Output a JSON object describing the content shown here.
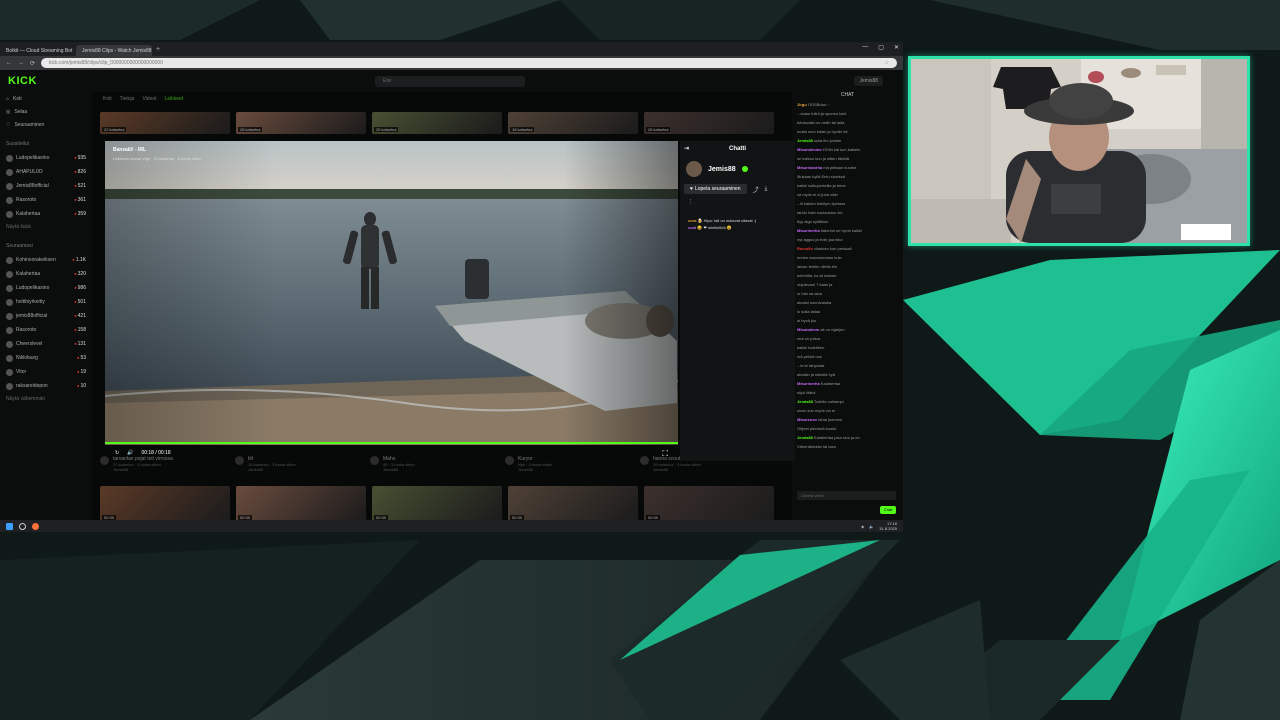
{
  "browser": {
    "tabs": [
      {
        "label": "Botkit — Cloud Streaming Bot",
        "color": "#e74c3c"
      },
      {
        "label": "Jemis88 Clips - Watch Jemis88",
        "color": "#53fc18"
      }
    ],
    "url": "kick.com/jemis88/clips/clip_0000000000000000000",
    "window_controls": [
      "—",
      "▢",
      "✕"
    ]
  },
  "kick": {
    "logo": "KICK",
    "search_placeholder": "Etsi",
    "user_button": "Jemis88",
    "nav": [
      {
        "label": "Koti",
        "icon": "home-icon"
      },
      {
        "label": "Selaa",
        "icon": "browse-icon"
      },
      {
        "label": "Seuraaminen",
        "icon": "heart-icon"
      }
    ],
    "recommended_label": "Suositellut",
    "recommended": [
      {
        "name": "Ludopelikasino",
        "count": "935"
      },
      {
        "name": "AHAPUL0O",
        "count": "826"
      },
      {
        "name": "Jemis88official",
        "count": "521"
      },
      {
        "name": "Rasoroto",
        "count": "361"
      },
      {
        "name": "Kalahertaa",
        "count": "359"
      }
    ],
    "show_more": "Näytä lisää",
    "following_label": "Seuraamasi",
    "following": [
      {
        "name": "Kohinoorakeiksen",
        "count": "1.1K"
      },
      {
        "name": "Kalahertaa",
        "count": "320"
      },
      {
        "name": "Ludopelikasino",
        "count": "986"
      },
      {
        "name": "hoitibiyrkeitty",
        "count": "501"
      },
      {
        "name": "jemis88official",
        "count": "421"
      },
      {
        "name": "Rasoroto",
        "count": "158"
      },
      {
        "name": "Cheerslevel",
        "count": "131"
      },
      {
        "name": "Nikkilaurg",
        "count": "53"
      },
      {
        "name": "Vitor",
        "count": "19"
      },
      {
        "name": "raksareidepon",
        "count": "10"
      }
    ],
    "show_less": "Näytä vähemmän",
    "content_tabs": [
      "Koti",
      "Tietoja",
      "Videot",
      "Leikkeet"
    ],
    "top_thumbs": [
      "22 katselua",
      "28 katselua",
      "25 katselua",
      "18 katselua",
      "28 katselua"
    ],
    "bottom_thumbs": [
      "00:30",
      "00:30",
      "00:30",
      "00:30",
      "00:30"
    ],
    "clip_cards": [
      {
        "title": "tarvanlan pojat teit virrossa",
        "sub": "27 katselua · 3 tuntia sitten",
        "author": "Jemis88"
      },
      {
        "title": "tiit",
        "sub": "15 katselua · 3 tuntia sitten",
        "author": "Jemis88"
      },
      {
        "title": "Maho",
        "sub": "45 · 3 tuntia sitten",
        "author": "Jemis88"
      },
      {
        "title": "Kuryor",
        "sub": "Nyk · 3 tuntia sitten",
        "author": "Jemis88"
      },
      {
        "title": "hanna scoutsia",
        "sub": "39 katselua · 3 tuntia sitten",
        "author": "Jemis88"
      }
    ],
    "page_chat": {
      "title": "CHAT",
      "lines": [
        {
          "user": "Jirgu",
          "text": "OOSBdoo ::",
          "color": "#e8a23a"
        },
        {
          "user": "",
          "text": "...ctaan tullut ja sponsu kuld",
          "color": ""
        },
        {
          "user": "",
          "text": "tuloisvalla on neliin tai laita",
          "color": ""
        },
        {
          "user": "",
          "text": "muita mun kalan ja hyvän ite",
          "color": ""
        },
        {
          "user": "Jemis88",
          "text": "sulla ibo joinlee",
          "color": "#53fc18"
        },
        {
          "user": "Misundenmo",
          "text": "HOlin kai kun katseis",
          "color": "#c86cfc"
        },
        {
          "user": "",
          "text": "se katsuo kun ja sitten ittekilä",
          "color": ""
        },
        {
          "user": "Misurinaorha",
          "text": "mä peltaan nuutse",
          "color": "#c86cfc"
        },
        {
          "user": "",
          "text": "Mukaan kyllä Entu siveissä",
          "color": ""
        },
        {
          "user": "",
          "text": "kaikki sulkuperteilla ja teme",
          "color": ""
        },
        {
          "user": "",
          "text": "sa myös ei ol juna näin",
          "color": ""
        },
        {
          "user": "",
          "text": "...ill kaiken birkitym lipelaus",
          "color": ""
        },
        {
          "user": "",
          "text": "tahdo hain suutaustuu kin",
          "color": ""
        },
        {
          "user": "",
          "text": "ttyy aigo kylläikun",
          "color": ""
        },
        {
          "user": "Misurinerha",
          "text": "tiatorimi on hyvin kaikki",
          "color": "#c86cfc"
        },
        {
          "user": "",
          "text": "nyt aggus ja bvbr jaa toko",
          "color": ""
        },
        {
          "user": "Rmcollo",
          "text": "vihainen kun pentaali",
          "color": "#e33"
        },
        {
          "user": "",
          "text": "ennen essomunamu kuin",
          "color": ""
        },
        {
          "user": "",
          "text": "laivan tehtiin ollettu tiin",
          "color": ""
        },
        {
          "user": "",
          "text": "tulehdita, ks at sinisen",
          "color": ""
        },
        {
          "user": "",
          "text": "ohjolevani 7 kaan ja",
          "color": ""
        },
        {
          "user": "",
          "text": "lo hän sa aina",
          "color": ""
        },
        {
          "user": "",
          "text": "ainatui sonnivalaha",
          "color": ""
        },
        {
          "user": "",
          "text": "lo sulla laitaa",
          "color": ""
        },
        {
          "user": "",
          "text": "ai hyvä joo",
          "color": ""
        },
        {
          "user": "Misundenm",
          "text": "ali on vijahjen",
          "color": "#c86cfc"
        },
        {
          "user": "",
          "text": "mut on juttua",
          "color": ""
        },
        {
          "user": "",
          "text": "kaikki todelleen",
          "color": ""
        },
        {
          "user": "",
          "text": "mä pelinä nos",
          "color": ""
        },
        {
          "user": "",
          "text": "...la te tahpoida",
          "color": ""
        },
        {
          "user": "",
          "text": "ainakin ja mikstiä hyä",
          "color": ""
        },
        {
          "user": "Misurinerha",
          "text": "Kalahertaa",
          "color": "#c86cfc"
        },
        {
          "user": "",
          "text": "siiyö iitämi",
          "color": ""
        },
        {
          "user": "Jemis88",
          "text": "Todella vahlampi",
          "color": "#53fc18"
        },
        {
          "user": "",
          "text": "sivun kun myös voi ei",
          "color": ""
        },
        {
          "user": "Misureuvo",
          "text": "tahai juomme",
          "color": "#c86cfc"
        },
        {
          "user": "",
          "text": "Ohjeet pienissä kuulut",
          "color": ""
        },
        {
          "user": "Jemis88",
          "text": "Kalahertaa joka sivu ja en",
          "color": "#53fc18"
        },
        {
          "user": "",
          "text": "Vähentämään tai taso",
          "color": ""
        }
      ],
      "input_placeholder": "Lähetä viesti",
      "send_label": "Chat"
    },
    "clip_modal": {
      "title": "Banzaiii! - IRL",
      "subtitle": "Leikkeen luonut Vige · 21 katselua · 8 tuntia sitten",
      "time": "00:18 / 00:18",
      "progress": 1.0,
      "chat_header": "Chatti",
      "streamer": "Jemis88",
      "follow_label": "Lopeta seuraaminen",
      "messages": [
        {
          "user": "cora",
          "text": "🍺 Hipo: tali on nukevat citavat :(",
          "cls": "u"
        },
        {
          "user": "cool",
          "text": "😀 ❤ mielikölöö 😆",
          "cls": "u2"
        }
      ]
    },
    "taskbar": {
      "time": "17:16",
      "date": "31.8.2025"
    }
  },
  "overlay": {
    "accent": "#2de2a8",
    "webcam_border": "#2de2a8"
  }
}
